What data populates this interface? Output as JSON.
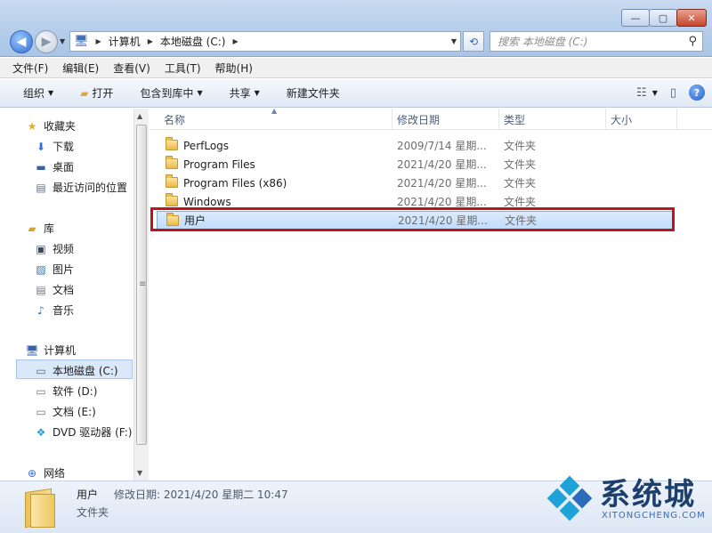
{
  "window": {
    "minimize_glyph": "—",
    "maximize_glyph": "▢",
    "close_glyph": "✕"
  },
  "address": {
    "crumbs": [
      "计算机",
      "本地磁盘 (C:)"
    ],
    "search_placeholder": "搜索 本地磁盘 (C:)"
  },
  "menu": [
    "文件(F)",
    "编辑(E)",
    "查看(V)",
    "工具(T)",
    "帮助(H)"
  ],
  "toolbar": {
    "organize": "组织",
    "open": "打开",
    "include_library": "包含到库中",
    "share": "共享",
    "new_folder": "新建文件夹",
    "help": "?"
  },
  "nav": {
    "favorites": "收藏夹",
    "favorites_items": [
      "下载",
      "桌面",
      "最近访问的位置"
    ],
    "libraries": "库",
    "libraries_items": [
      "视频",
      "图片",
      "文档",
      "音乐"
    ],
    "computer": "计算机",
    "computer_items": [
      "本地磁盘 (C:)",
      "软件 (D:)",
      "文档 (E:)",
      "DVD 驱动器 (F:)"
    ],
    "network": "网络"
  },
  "columns": [
    "名称",
    "修改日期",
    "类型",
    "大小"
  ],
  "files": [
    {
      "name": "PerfLogs",
      "date": "2009/7/14 星期...",
      "type": "文件夹"
    },
    {
      "name": "Program Files",
      "date": "2021/4/20 星期...",
      "type": "文件夹"
    },
    {
      "name": "Program Files (x86)",
      "date": "2021/4/20 星期...",
      "type": "文件夹"
    },
    {
      "name": "Windows",
      "date": "2021/4/20 星期...",
      "type": "文件夹"
    },
    {
      "name": "用户",
      "date": "2021/4/20 星期...",
      "type": "文件夹"
    }
  ],
  "details": {
    "name": "用户",
    "modified_label": "修改日期: 2021/4/20 星期二 10:47",
    "type": "文件夹"
  },
  "watermark": {
    "text": "系统城",
    "sub": "XITONGCHENG.COM"
  },
  "colors": {
    "highlight": "#b8151c",
    "accent": "#2f6fd6"
  }
}
